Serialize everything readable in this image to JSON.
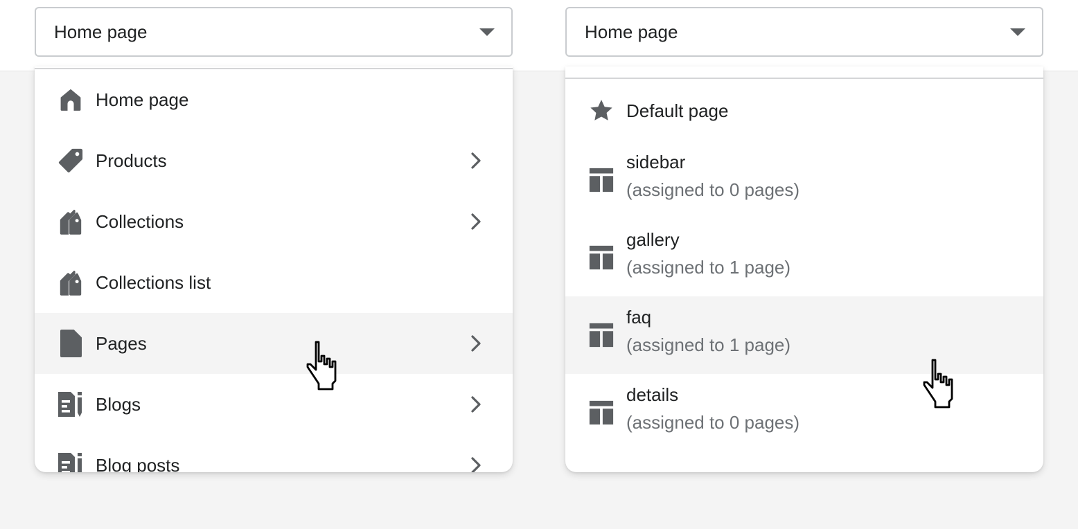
{
  "left": {
    "select": {
      "value": "Home page"
    },
    "items": [
      {
        "label": "Home page",
        "icon": "home-icon",
        "has_submenu": false
      },
      {
        "label": "Products",
        "icon": "tag-icon",
        "has_submenu": true
      },
      {
        "label": "Collections",
        "icon": "collection-tags-icon",
        "has_submenu": true
      },
      {
        "label": "Collections list",
        "icon": "collection-tags-icon",
        "has_submenu": false
      },
      {
        "label": "Pages",
        "icon": "page-icon",
        "has_submenu": true,
        "hovered": true
      },
      {
        "label": "Blogs",
        "icon": "blog-icon",
        "has_submenu": true
      },
      {
        "label": "Blog posts",
        "icon": "blog-icon",
        "has_submenu": true
      }
    ]
  },
  "right": {
    "select": {
      "value": "Home page"
    },
    "default_item": {
      "label": "Default page",
      "icon": "star-icon"
    },
    "templates": [
      {
        "name": "sidebar",
        "assigned": "(assigned to 0 pages)",
        "icon": "template-icon"
      },
      {
        "name": "gallery",
        "assigned": "(assigned to 1 page)",
        "icon": "template-icon"
      },
      {
        "name": "faq",
        "assigned": "(assigned to 1 page)",
        "icon": "template-icon",
        "hovered": true
      },
      {
        "name": "details",
        "assigned": "(assigned to 0 pages)",
        "icon": "template-icon"
      }
    ]
  },
  "colors": {
    "icon": "#5c5f62",
    "text": "#202223",
    "subdued": "#6d7175",
    "hover_bg": "#f4f4f4"
  }
}
